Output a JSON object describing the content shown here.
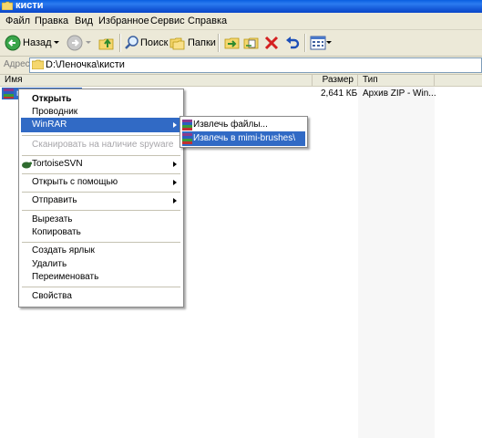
{
  "window": {
    "title": "кисти"
  },
  "menubar": [
    "Файл",
    "Правка",
    "Вид",
    "Избранное",
    "Сервис",
    "Справка"
  ],
  "toolbar": {
    "back": "Назад",
    "search": "Поиск",
    "folders": "Папки"
  },
  "address": {
    "label": "Адрес",
    "path": "D:\\Леночка\\кисти"
  },
  "columns": {
    "name": "Имя",
    "size": "Размер",
    "type": "Тип"
  },
  "file": {
    "name": "mimi-brushes",
    "size": "2,641 КБ",
    "type": "Архив ZIP - Win..."
  },
  "context_menu": {
    "items": [
      "Открыть",
      "Проводник",
      "WinRAR",
      "Сканировать на наличие spyware",
      "TortoiseSVN",
      "Открыть с помощью",
      "Отправить",
      "Вырезать",
      "Копировать",
      "Создать ярлык",
      "Удалить",
      "Переименовать",
      "Свойства"
    ]
  },
  "winrar_submenu": {
    "items": [
      "Извлечь файлы...",
      "Извлечь в mimi-brushes\\"
    ]
  },
  "colors": {
    "highlight": "#316ac5",
    "titlebar": "#0a47c8",
    "chrome": "#ece9d8"
  }
}
